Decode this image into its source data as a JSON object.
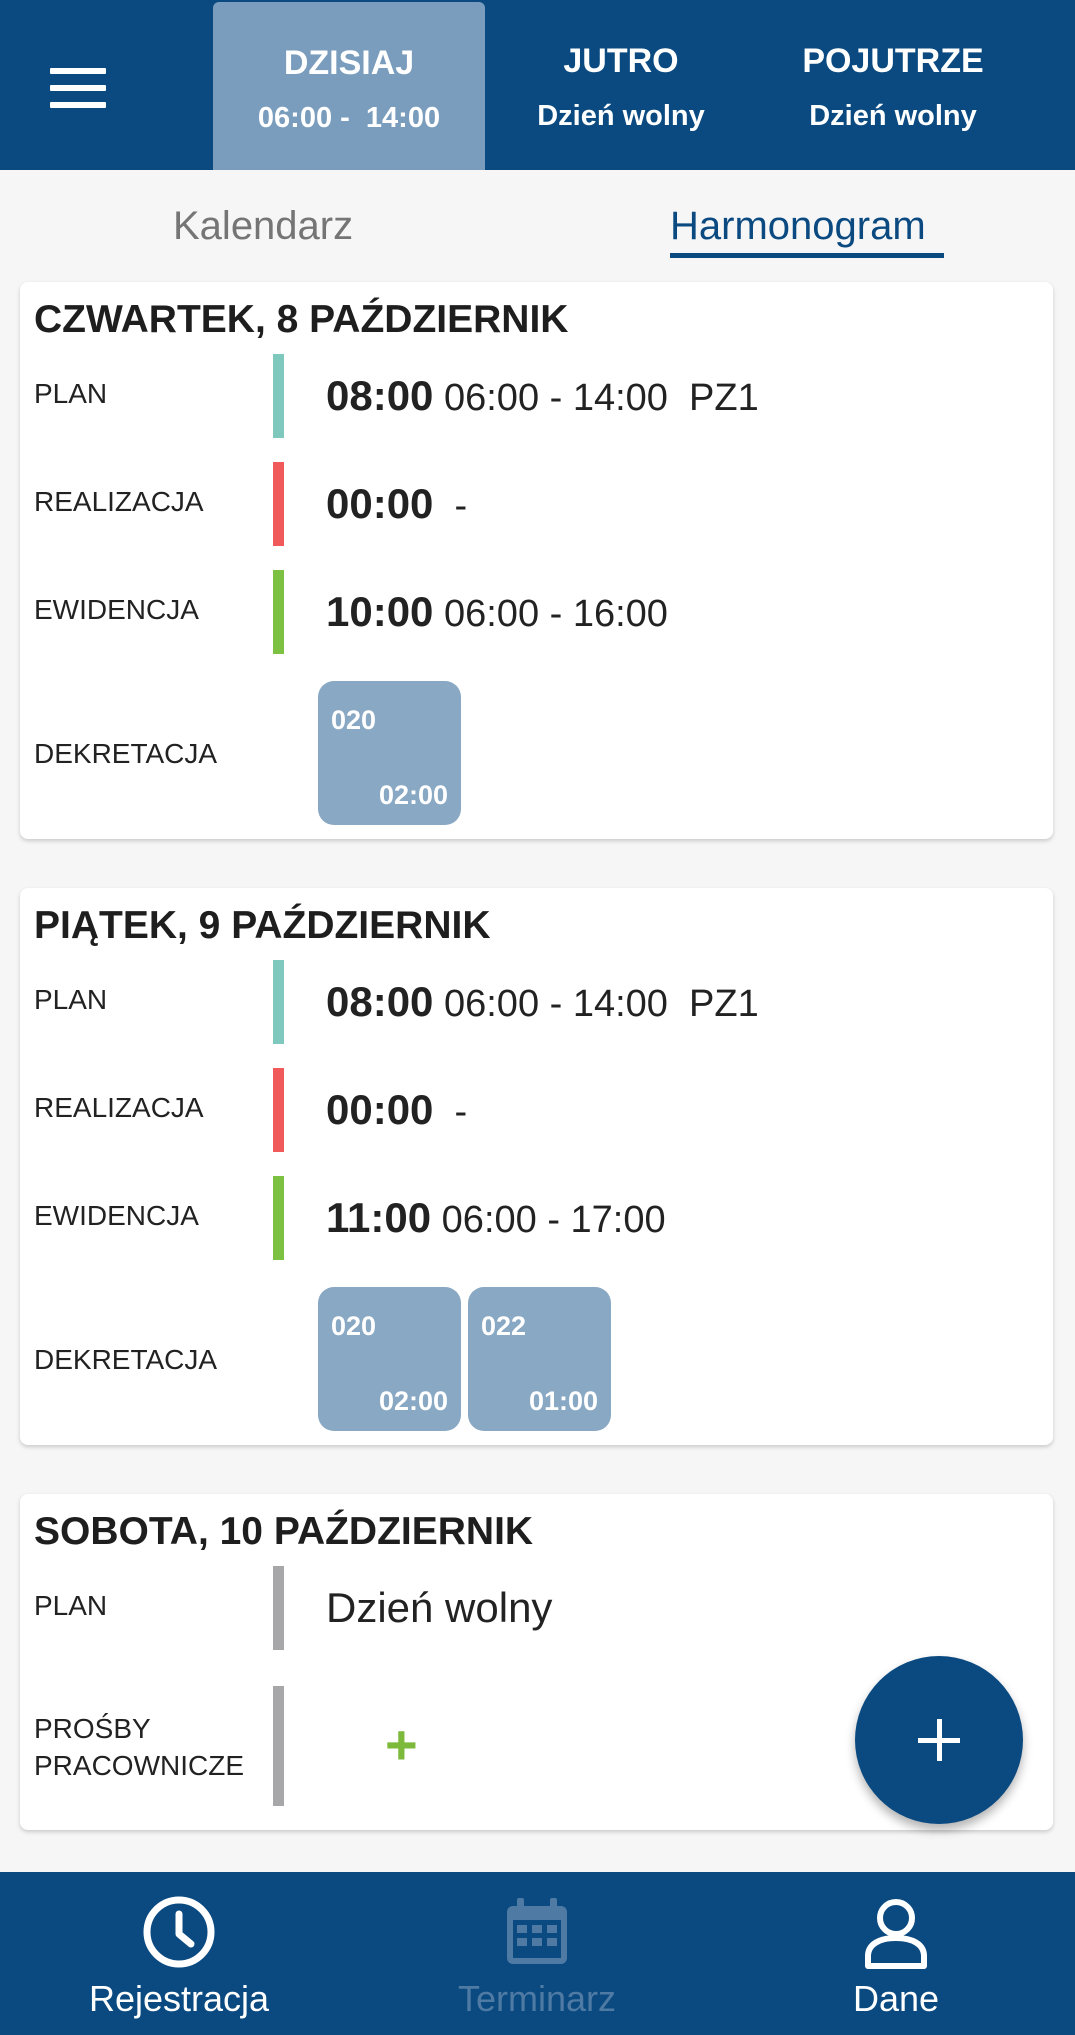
{
  "header": {
    "menu_icon": "hamburger-menu-icon",
    "tabs": [
      {
        "title": "DZISIAJ",
        "subtitle": "06:00 -  14:00",
        "active": true
      },
      {
        "title": "JUTRO",
        "subtitle": "Dzień wolny",
        "active": false
      },
      {
        "title": "POJUTRZE",
        "subtitle": "Dzień wolny",
        "active": false
      }
    ]
  },
  "subtabs": {
    "calendar": "Kalendarz",
    "schedule": "Harmonogram",
    "active": "Harmonogram"
  },
  "colors": {
    "primary": "#0a4a80",
    "plan": "#7fc8be",
    "realizacja": "#f05a5a",
    "ewidencja": "#7dc142",
    "free": "#a7a7a9",
    "chip": "#89a8c4"
  },
  "days": [
    {
      "title": "CZWARTEK, 8 PAŹDZIERNIK",
      "plan": {
        "label": "PLAN",
        "hours": "08:00",
        "range": "06:00 - 14:00  PZ1"
      },
      "realizacja": {
        "label": "REALIZACJA",
        "hours": "00:00",
        "range": " -"
      },
      "ewidencja": {
        "label": "EWIDENCJA",
        "hours": "10:00",
        "range": "06:00 - 16:00"
      },
      "dekretacja": {
        "label": "DEKRETACJA",
        "chips": [
          {
            "code": "020",
            "time": "02:00"
          }
        ]
      }
    },
    {
      "title": "PIĄTEK, 9 PAŹDZIERNIK",
      "plan": {
        "label": "PLAN",
        "hours": "08:00",
        "range": "06:00 - 14:00  PZ1"
      },
      "realizacja": {
        "label": "REALIZACJA",
        "hours": "00:00",
        "range": " -"
      },
      "ewidencja": {
        "label": "EWIDENCJA",
        "hours": "11:00",
        "range": "06:00 - 17:00"
      },
      "dekretacja": {
        "label": "DEKRETACJA",
        "chips": [
          {
            "code": "020",
            "time": "02:00"
          },
          {
            "code": "022",
            "time": "01:00"
          }
        ]
      }
    },
    {
      "title": "SOBOTA, 10 PAŹDZIERNIK",
      "plan": {
        "label": "PLAN",
        "value": "Dzień wolny"
      },
      "requests": {
        "label_line1": "PROŚBY",
        "label_line2": "PRACOWNICZE",
        "add_symbol": "+"
      }
    }
  ],
  "fab": {
    "icon": "plus-icon"
  },
  "bottom_nav": [
    {
      "label": "Rejestracja",
      "icon": "clock-icon",
      "enabled": true
    },
    {
      "label": "Terminarz",
      "icon": "calendar-icon",
      "enabled": false
    },
    {
      "label": "Dane",
      "icon": "user-icon",
      "enabled": true
    }
  ]
}
